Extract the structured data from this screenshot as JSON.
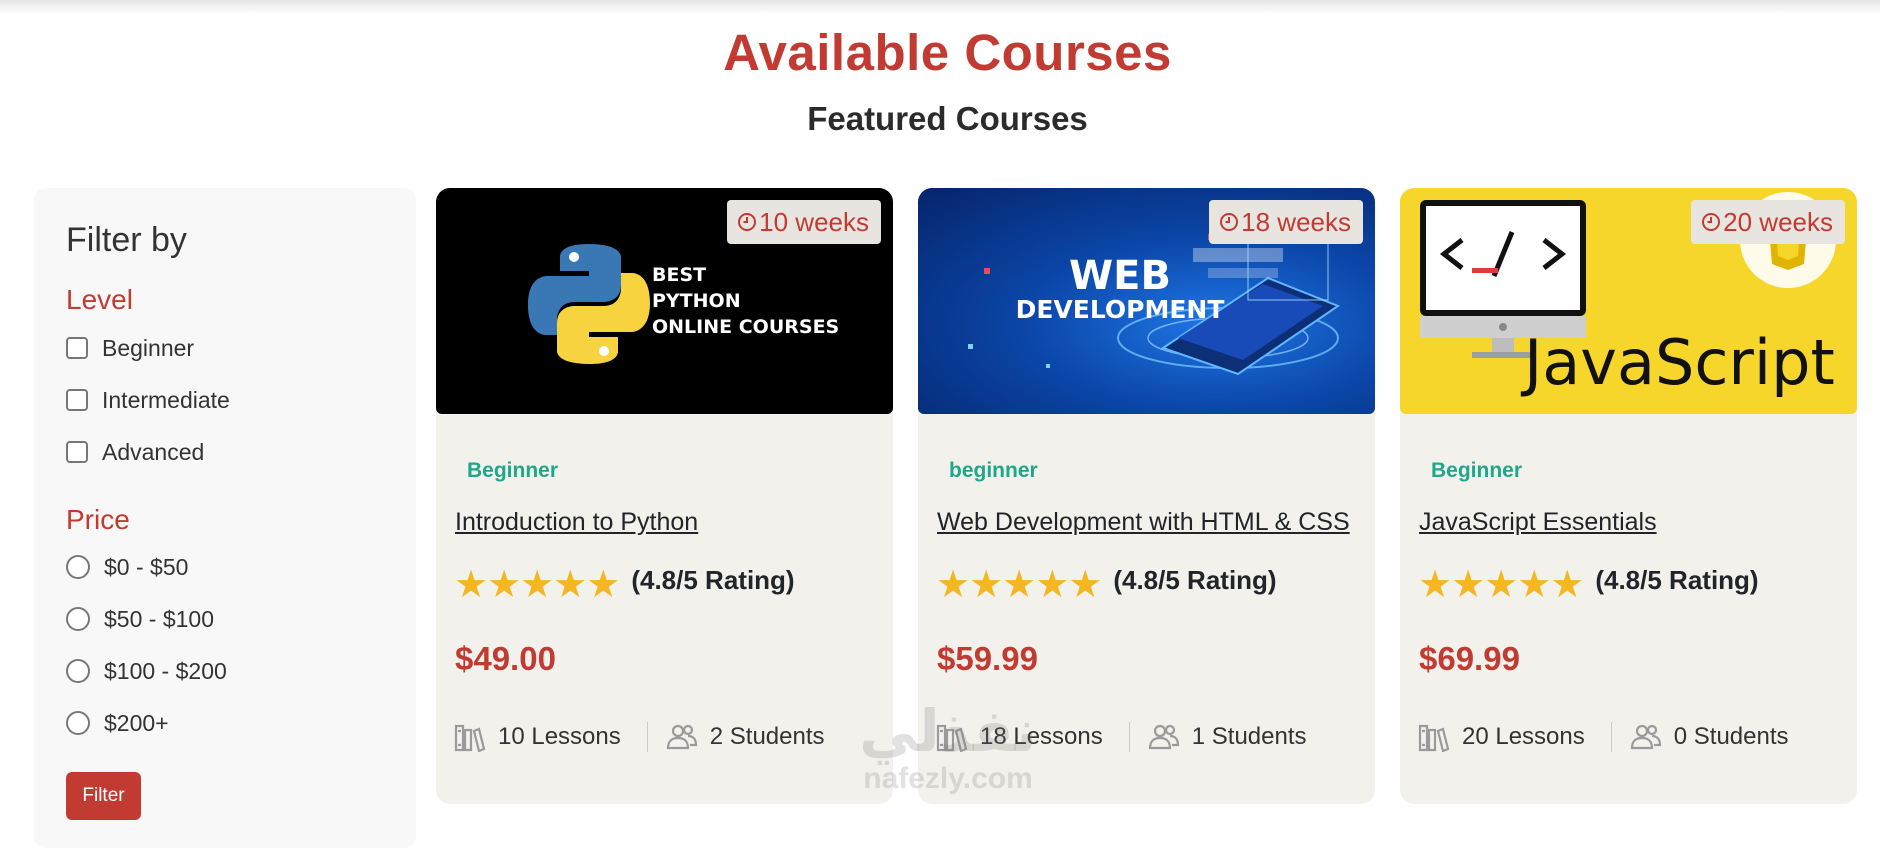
{
  "header": {
    "title": "Available Courses",
    "subtitle": "Featured Courses"
  },
  "sidebar": {
    "title": "Filter by",
    "level": {
      "title": "Level",
      "options": [
        "Beginner",
        "Intermediate",
        "Advanced"
      ]
    },
    "price": {
      "title": "Price",
      "options": [
        "$0 - $50",
        "$50 - $100",
        "$100 - $200",
        "$200+"
      ]
    },
    "filter_button": "Filter"
  },
  "courses": [
    {
      "duration": "10 weeks",
      "level": "Beginner",
      "title": "Introduction to Python",
      "rating": 4.8,
      "rating_text": "(4.8/5 Rating)",
      "price": "$49.00",
      "lessons": "10 Lessons",
      "students": "2 Students",
      "image": {
        "text_lines": [
          "BEST",
          "PYTHON",
          "ONLINE COURSES"
        ],
        "background": "#000000",
        "logo": "python-logo-icon"
      }
    },
    {
      "duration": "18 weeks",
      "level": "beginner",
      "title": "Web Development with HTML & CSS",
      "rating": 4.8,
      "rating_text": "(4.8/5 Rating)",
      "price": "$59.99",
      "lessons": "18 Lessons",
      "students": "1 Students",
      "image": {
        "text_lines": [
          "WEB",
          "DEVELOPMENT"
        ],
        "background": "#0a3f9a",
        "logo": "laptop-icon"
      }
    },
    {
      "duration": "20 weeks",
      "level": "Beginner",
      "title": "JavaScript Essentials",
      "rating": 4.8,
      "rating_text": "(4.8/5 Rating)",
      "price": "$69.99",
      "lessons": "20 Lessons",
      "students": "0 Students",
      "image": {
        "text_lines": [
          "JavaScript"
        ],
        "background": "#f7d62c",
        "logo": "monitor-code-icon"
      }
    }
  ],
  "watermark": {
    "arabic": "نفذلي",
    "latin": "nafezly.com"
  },
  "colors": {
    "accent": "#c23b33",
    "level": "#1ea889",
    "star": "#f4b623",
    "card_bg": "#f3f1ec"
  }
}
